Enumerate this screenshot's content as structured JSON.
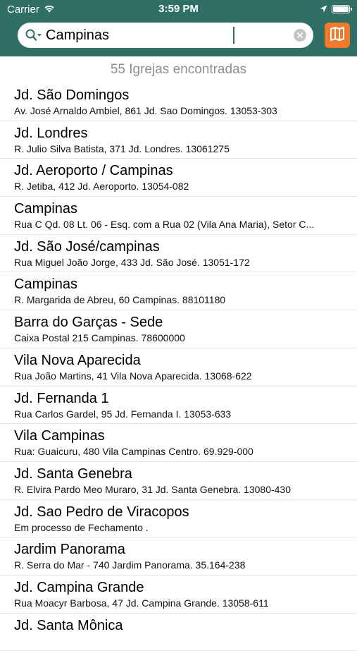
{
  "status_bar": {
    "carrier": "Carrier",
    "time": "3:59 PM",
    "battery_level": 1.0
  },
  "search": {
    "value": "Campinas",
    "placeholder": ""
  },
  "results": {
    "count_text": "55 Igrejas encontradas",
    "items": [
      {
        "title": "Jd. São Domingos",
        "address": "Av. José Arnaldo Ambiel, 861 Jd. Sao Domingos. 13053-303"
      },
      {
        "title": "Jd. Londres",
        "address": "R. Julio Silva Batista, 371 Jd. Londres. 13061275"
      },
      {
        "title": "Jd. Aeroporto / Campinas",
        "address": "R. Jetiba, 412 Jd. Aeroporto. 13054-082"
      },
      {
        "title": "Campinas",
        "address": "Rua C Qd. 08 Lt. 06 - Esq. com a Rua 02 (Vila Ana Maria), Setor C..."
      },
      {
        "title": "Jd. São José/campinas",
        "address": "Rua Miguel João Jorge, 433 Jd. São José. 13051-172"
      },
      {
        "title": "Campinas",
        "address": "R. Margarida de Abreu, 60 Campinas. 88101180"
      },
      {
        "title": "Barra do Garças - Sede",
        "address": "Caixa Postal 215 Campinas. 78600000"
      },
      {
        "title": "Vila Nova Aparecida",
        "address": "Rua João Martins, 41 Vila Nova Aparecida. 13068-622"
      },
      {
        "title": "Jd. Fernanda 1",
        "address": "Rua Carlos Gardel, 95 Jd. Fernanda I. 13053-633"
      },
      {
        "title": "Vila Campinas",
        "address": "Rua: Guaicuru, 480  Vila Campinas Centro. 69.929-000"
      },
      {
        "title": "Jd. Santa Genebra",
        "address": "R. Elvira Pardo Meo Muraro, 31 Jd. Santa Genebra. 13080-430"
      },
      {
        "title": "Jd. Sao Pedro de Viracopos",
        "address": "Em processo de Fechamento ."
      },
      {
        "title": "Jardim Panorama",
        "address": "R. Serra do Mar - 740 Jardim Panorama. 35.164-238"
      },
      {
        "title": "Jd. Campina Grande",
        "address": "Rua Moacyr Barbosa, 47 Jd. Campina Grande. 13058-611"
      },
      {
        "title": "Jd. Santa Mônica",
        "address": ""
      }
    ]
  },
  "colors": {
    "header": "#2f6f66",
    "map_button": "#f07a2a",
    "count_text": "#8e8e8e"
  },
  "icons": {
    "search": "search-icon",
    "clear": "clear-icon",
    "map": "map-icon",
    "wifi": "wifi-icon",
    "location": "location-arrow-icon",
    "battery": "battery-icon"
  }
}
